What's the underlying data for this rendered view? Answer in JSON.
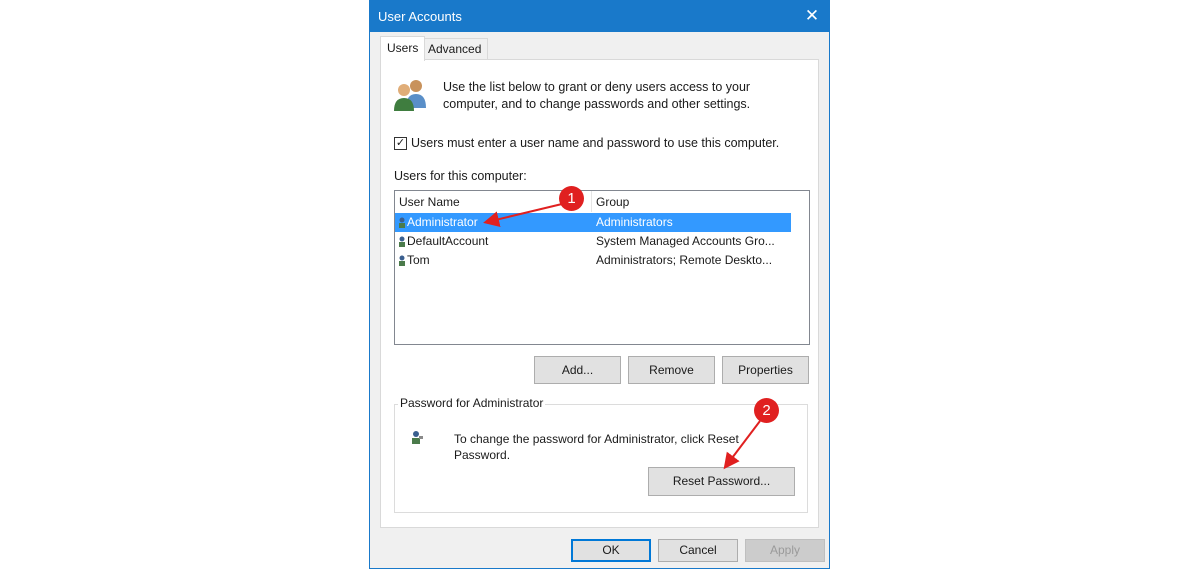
{
  "window": {
    "title": "User Accounts",
    "close_glyph": "✕"
  },
  "tabs": [
    {
      "label": "Users"
    },
    {
      "label": "Advanced"
    }
  ],
  "intro": {
    "line1": "Use the list below to grant or deny users access to your",
    "line2": "computer, and to change passwords and other settings."
  },
  "must_login": {
    "checked": true,
    "check_glyph": "✓",
    "label": "Users must enter a user name and password to use this computer."
  },
  "users_section": {
    "label": "Users for this computer:"
  },
  "list": {
    "columns": [
      "User Name",
      "Group"
    ],
    "rows": [
      {
        "name": "Administrator",
        "group": "Administrators",
        "selected": true
      },
      {
        "name": "DefaultAccount",
        "group": "System Managed Accounts Gro..."
      },
      {
        "name": "Tom",
        "group": "Administrators; Remote Deskto..."
      }
    ]
  },
  "list_buttons": {
    "add": "Add...",
    "remove": "Remove",
    "properties": "Properties"
  },
  "password_group": {
    "title": "Password for Administrator",
    "text_line1": "To change the password for Administrator, click Reset",
    "text_line2": "Password.",
    "reset_button": "Reset Password..."
  },
  "dialog_buttons": {
    "ok": "OK",
    "cancel": "Cancel",
    "apply": "Apply"
  },
  "annotations": {
    "step1": "1",
    "step2": "2",
    "color": "#e02020"
  },
  "colors": {
    "titlebar": "#1979ca",
    "selection": "#3399ff"
  }
}
